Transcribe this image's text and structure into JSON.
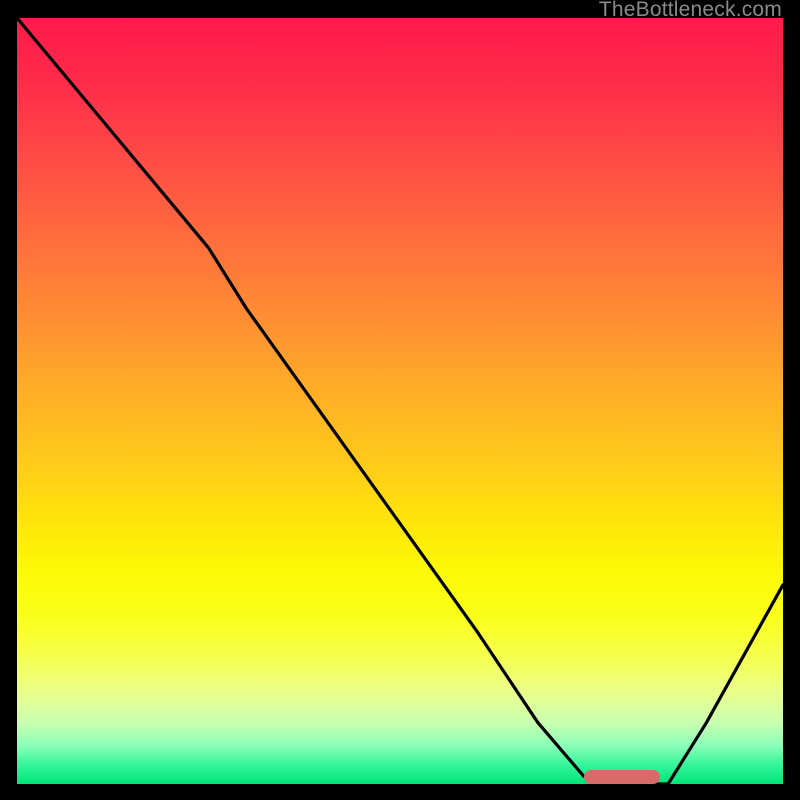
{
  "watermark": "TheBottleneck.com",
  "colors": {
    "frame_bg": "#000000",
    "marker": "#d96a6a",
    "curve": "#000000"
  },
  "chart_data": {
    "type": "line",
    "title": "",
    "xlabel": "",
    "ylabel": "",
    "xlim": [
      0,
      100
    ],
    "ylim": [
      0,
      100
    ],
    "grid": false,
    "series": [
      {
        "name": "bottleneck-curve",
        "x": [
          0,
          10,
          20,
          25,
          30,
          40,
          50,
          60,
          68,
          74,
          80,
          85,
          90,
          100
        ],
        "y": [
          100,
          88,
          76,
          70,
          62,
          48,
          34,
          20,
          8,
          1,
          0,
          0,
          8,
          26
        ]
      }
    ],
    "marker": {
      "x_start": 74,
      "x_end": 84,
      "y": 0
    }
  }
}
